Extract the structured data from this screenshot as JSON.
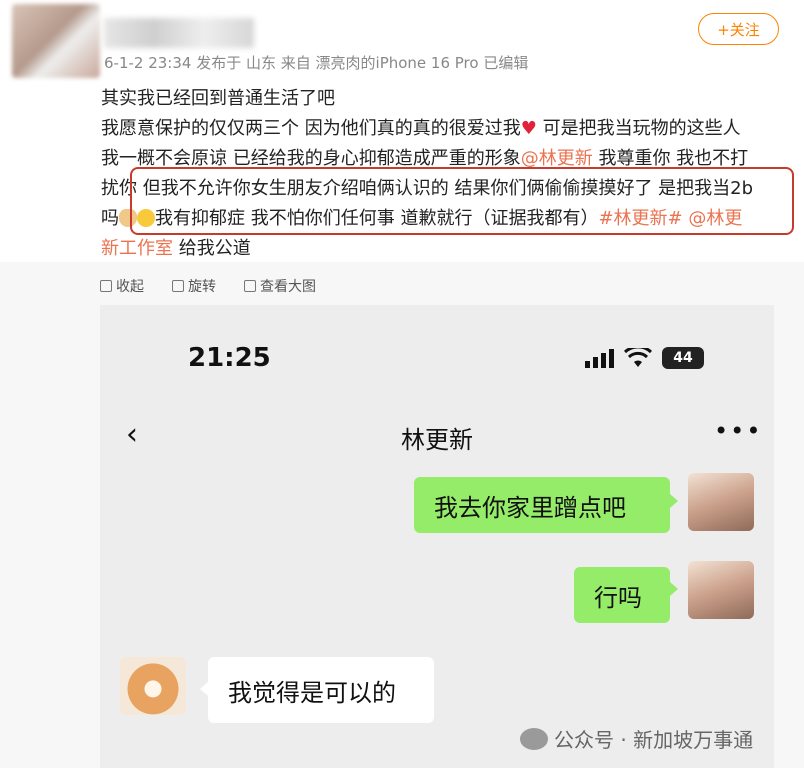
{
  "post": {
    "meta": "6-1-2 23:34 发布于 山东 来自 漂亮肉的iPhone 16 Pro 已编辑",
    "follow_label": "+关注",
    "line1": "其实我已经回到普通生活了吧",
    "line2_a": "我愿意保护的仅仅两三个 因为他们真的真的很爱过我",
    "line2_b": " 可是把我当玩物的这些人",
    "line3_a": "我一概不会原谅 已经给我的身心抑郁造成严重的形象",
    "line3_mention": "@林更新",
    "line3_b": " 我尊重你 我也不打",
    "line4": "扰你 但我不允许你女生朋友介绍咱俩认识的 结果你们俩偷偷摸摸好了 是把我当2b",
    "line5_a": "吗",
    "line5_b": "我有抑郁症 我不怕你们任何事 道歉就行（证据我都有）",
    "line5_tag": "#林更新#",
    "line5_mention": " @林更",
    "line6_mention": "新工作室",
    "line6_b": " 给我公道"
  },
  "toolbar": {
    "collapse": "收起",
    "rotate": "旋转",
    "view_large": "查看大图"
  },
  "phone": {
    "time": "21:25",
    "battery": "44",
    "chat_title": "林更新",
    "more": "•••",
    "back": "‹",
    "messages": [
      {
        "from": "me",
        "text": "我去你家里蹭点吧"
      },
      {
        "from": "me",
        "text": "行吗"
      },
      {
        "from": "other",
        "text": "我觉得是可以的"
      }
    ]
  },
  "watermark": "公众号 · 新加坡万事通",
  "colors": {
    "accent": "#ff8200",
    "link": "#eb7350",
    "bubble_me": "#95ec69",
    "highlight": "#c63c2c"
  }
}
